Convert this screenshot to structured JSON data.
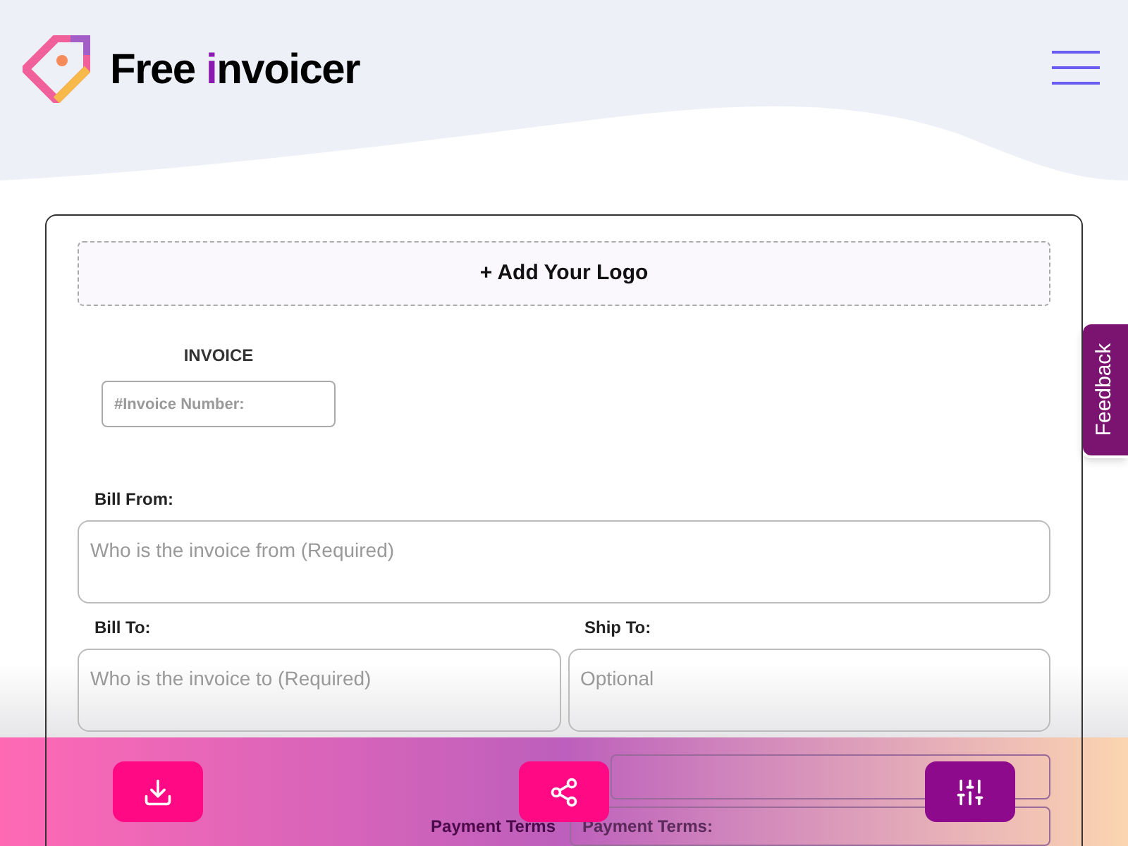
{
  "header": {
    "brand_words": [
      "Free",
      "invoicer"
    ]
  },
  "logo_upload": {
    "label": "+ Add Your Logo"
  },
  "invoice": {
    "title": "INVOICE",
    "number_placeholder": "#Invoice Number:"
  },
  "bill_from": {
    "label": "Bill From:",
    "placeholder": "Who is the invoice from (Required)"
  },
  "bill_to": {
    "label": "Bill To:",
    "placeholder": "Who is the invoice to (Required)"
  },
  "ship_to": {
    "label": "Ship To:",
    "placeholder": "Optional"
  },
  "payment_terms": {
    "label": "Payment Terms",
    "placeholder": "Payment Terms:"
  },
  "feedback": {
    "label": "Feedback"
  }
}
